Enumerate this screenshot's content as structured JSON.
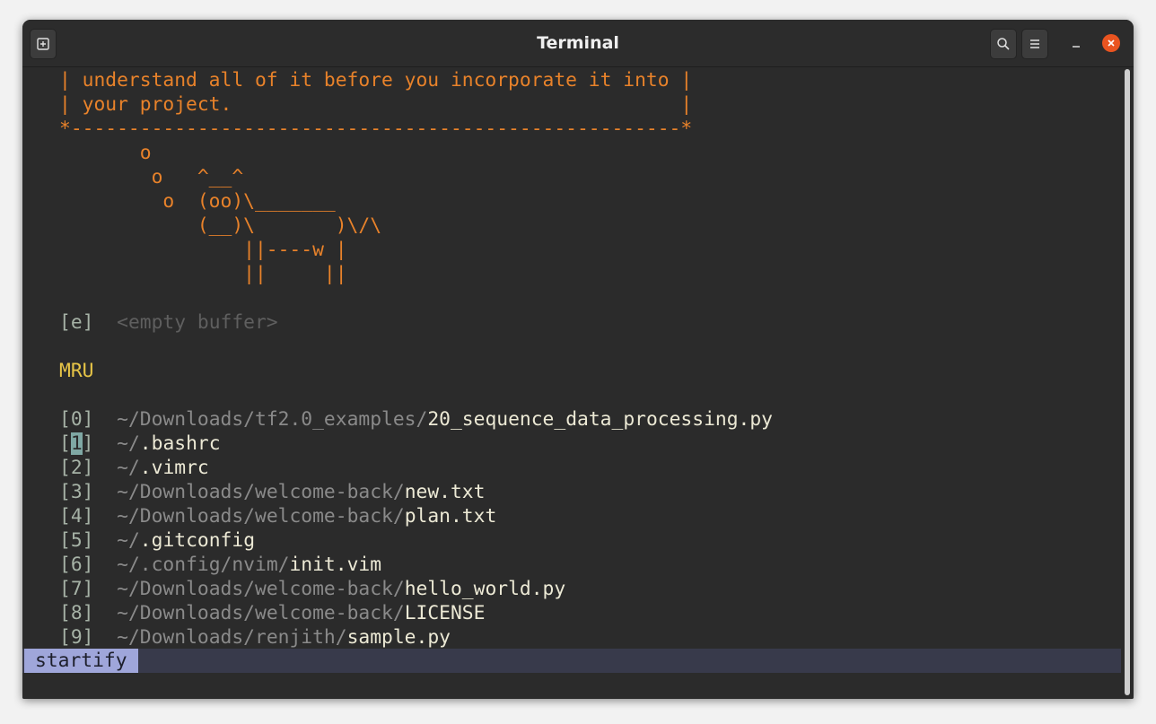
{
  "window": {
    "title": "Terminal"
  },
  "titlebar_icons": {
    "new_tab": "new-tab-icon",
    "search": "search-icon",
    "menu": "hamburger-menu-icon",
    "minimize": "minimize-icon",
    "close": "close-icon"
  },
  "startify": {
    "cow_lines": [
      "| understand all of it before you incorporate it into |",
      "| your project.                                       |",
      "*-----------------------------------------------------*",
      "       o",
      "        o   ^__^",
      "         o  (oo)\\_______",
      "            (__)\\       )\\/\\",
      "                ||----w |",
      "                ||     ||"
    ],
    "empty_entry": {
      "index": "[e]",
      "label": "<empty buffer>"
    },
    "mru_header": "MRU",
    "mru": [
      {
        "open": "[",
        "num": "0",
        "close": "]",
        "dir": "~/Downloads/tf2.0_examples/",
        "file": "20_sequence_data_processing.py"
      },
      {
        "open": "[",
        "num": "1",
        "close": "]",
        "dir": "~/",
        "file": ".bashrc"
      },
      {
        "open": "[",
        "num": "2",
        "close": "]",
        "dir": "~/",
        "file": ".vimrc"
      },
      {
        "open": "[",
        "num": "3",
        "close": "]",
        "dir": "~/Downloads/welcome-back/",
        "file": "new.txt"
      },
      {
        "open": "[",
        "num": "4",
        "close": "]",
        "dir": "~/Downloads/welcome-back/",
        "file": "plan.txt"
      },
      {
        "open": "[",
        "num": "5",
        "close": "]",
        "dir": "~/",
        "file": ".gitconfig"
      },
      {
        "open": "[",
        "num": "6",
        "close": "]",
        "dir": "~/.config/nvim/",
        "file": "init.vim"
      },
      {
        "open": "[",
        "num": "7",
        "close": "]",
        "dir": "~/Downloads/welcome-back/",
        "file": "hello_world.py"
      },
      {
        "open": "[",
        "num": "8",
        "close": "]",
        "dir": "~/Downloads/welcome-back/",
        "file": "LICENSE"
      },
      {
        "open": "[",
        "num": "9",
        "close": "]",
        "dir": "~/Downloads/renjith/",
        "file": "sample.py"
      }
    ]
  },
  "statusline": {
    "mode": "startify"
  },
  "colors": {
    "cow": "#e8822a",
    "header": "#e7c547",
    "mode_bg": "#9fa6da",
    "statusline_bg": "#383a4b",
    "close_button": "#e95420"
  }
}
